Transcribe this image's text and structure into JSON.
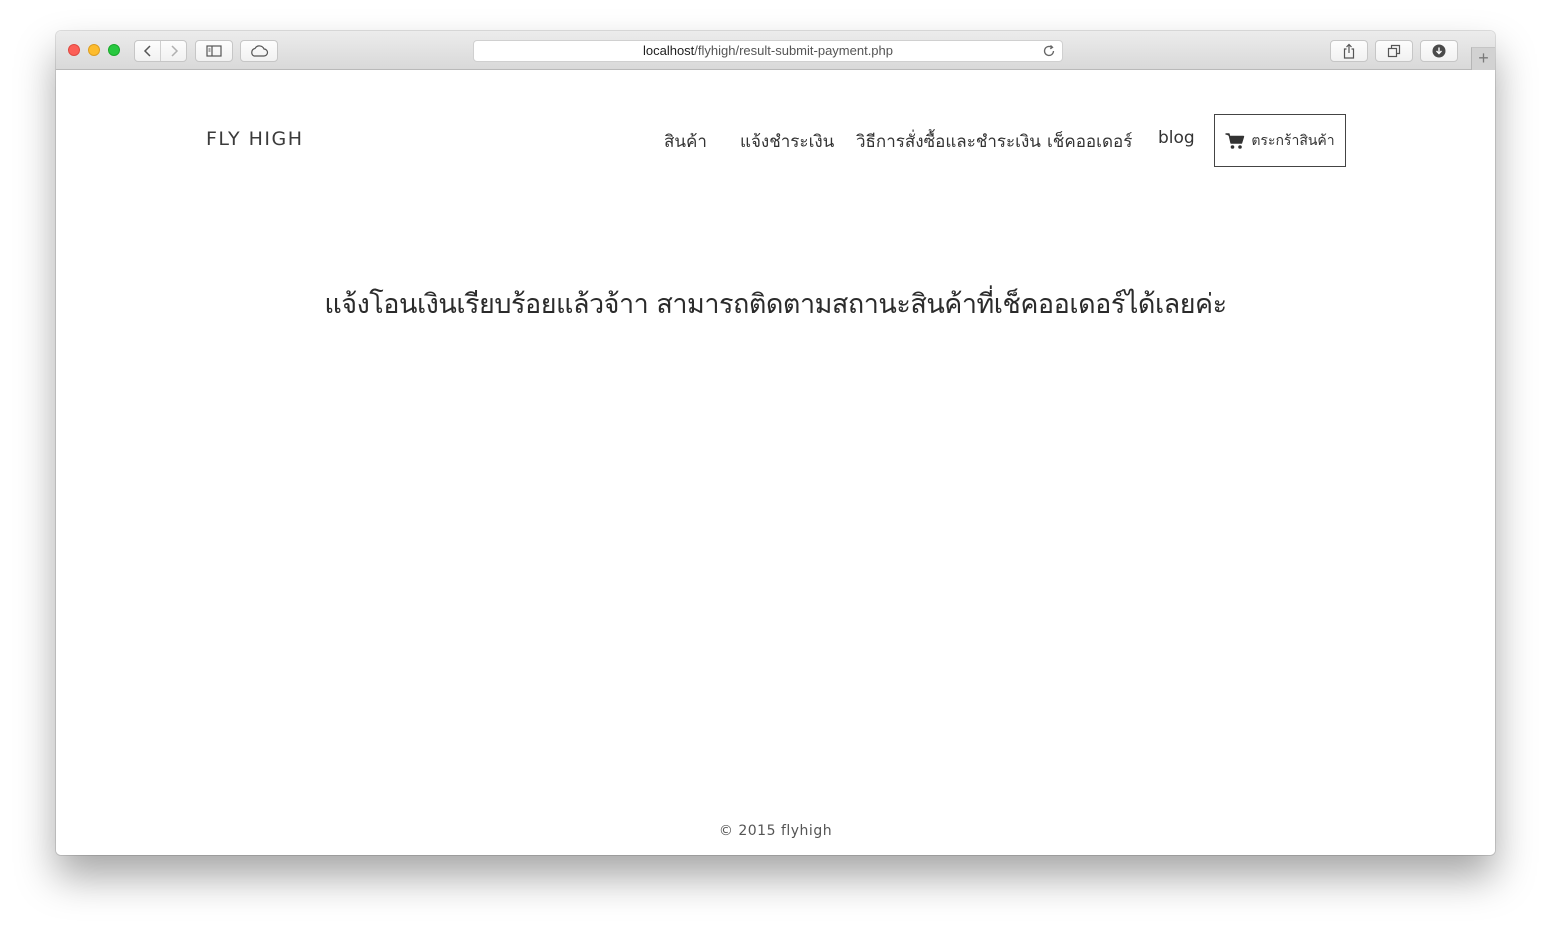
{
  "browser": {
    "url_host": "localhost",
    "url_path": "/flyhigh/result-submit-payment.php",
    "icons": {
      "close": "close-dot",
      "minimize": "minimize-dot",
      "zoom": "zoom-dot",
      "back": "chevron-left-icon",
      "forward": "chevron-right-icon",
      "sidebar": "sidebar-icon",
      "cloud": "cloud-icon",
      "reload": "reload-icon",
      "share": "share-icon",
      "tabs": "tabs-icon",
      "download": "download-icon",
      "new_tab": "plus-icon"
    },
    "new_tab_label": "+"
  },
  "header": {
    "brand": "FLY HIGH",
    "nav": [
      {
        "label": "สินค้า"
      },
      {
        "label": "แจ้งชำระเงิน"
      },
      {
        "label": "วิธีการสั่งซื้อและชำระเงิน"
      },
      {
        "label": "เช็คออเดอร์"
      },
      {
        "label": "blog"
      }
    ],
    "cart_label": "ตระกร้าสินค้า",
    "cart_icon": "cart-icon"
  },
  "main": {
    "message": "แจ้งโอนเงินเรียบร้อยแล้วจ้าา สามารถติดตามสถานะสินค้าที่เช็คออเดอร์ได้เลยค่ะ"
  },
  "footer": {
    "copyright": "©  2015  flyhigh"
  },
  "colors": {
    "close": "#fc5f57",
    "minimize": "#fdbc2e",
    "zoom": "#28c840",
    "text": "#333333"
  }
}
